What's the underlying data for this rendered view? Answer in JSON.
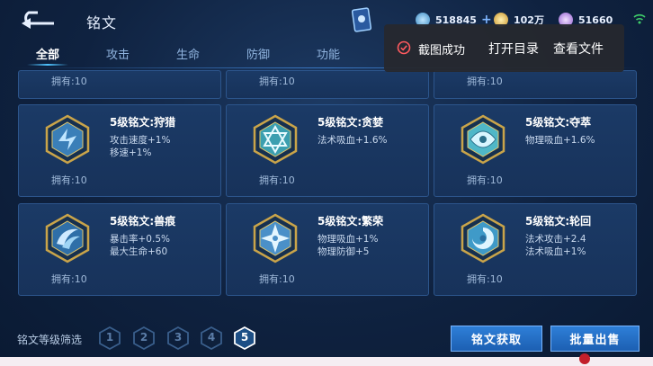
{
  "header": {
    "title": "铭文",
    "currencies": [
      {
        "name": "gold-coin",
        "value": "518845",
        "has_plus": true,
        "color": "#5fa8d8"
      },
      {
        "name": "diamond",
        "value": "102万",
        "has_plus": false,
        "color": "#d9b24a"
      },
      {
        "name": "crystal",
        "value": "51660",
        "has_plus": false,
        "color": "#b58fe0"
      }
    ]
  },
  "tabs": [
    "全部",
    "攻击",
    "生命",
    "防御",
    "功能"
  ],
  "active_tab": 0,
  "top_row_owned": [
    "拥有:10",
    "拥有:10",
    "拥有:10"
  ],
  "cards": [
    {
      "name": "5级铭文:狩猎",
      "stats": [
        "攻击速度+1%",
        "移速+1%"
      ],
      "owned": "拥有:10",
      "color": "#4fa0d8"
    },
    {
      "name": "5级铭文:贪婪",
      "stats": [
        "法术吸血+1.6%"
      ],
      "owned": "拥有:10",
      "color": "#5fc2d0"
    },
    {
      "name": "5级铭文:夺萃",
      "stats": [
        "物理吸血+1.6%"
      ],
      "owned": "拥有:10",
      "color": "#6fc8d8"
    },
    {
      "name": "5级铭文:兽痕",
      "stats": [
        "暴击率+0.5%",
        "最大生命+60"
      ],
      "owned": "拥有:10",
      "color": "#4f9fd0"
    },
    {
      "name": "5级铭文:繁荣",
      "stats": [
        "物理吸血+1%",
        "物理防御+5"
      ],
      "owned": "拥有:10",
      "color": "#6fb8e8"
    },
    {
      "name": "5级铭文:轮回",
      "stats": [
        "法术攻击+2.4",
        "法术吸血+1%"
      ],
      "owned": "拥有:10",
      "color": "#5fb0d8"
    }
  ],
  "toast": {
    "message": "截图成功",
    "open_folder": "打开目录",
    "view_file": "查看文件"
  },
  "filter": {
    "label": "铭文等级筛选",
    "levels": [
      "1",
      "2",
      "3",
      "4",
      "5"
    ],
    "active_level": "5"
  },
  "buttons": {
    "obtain": "铭文获取",
    "batch_sell": "批量出售"
  }
}
